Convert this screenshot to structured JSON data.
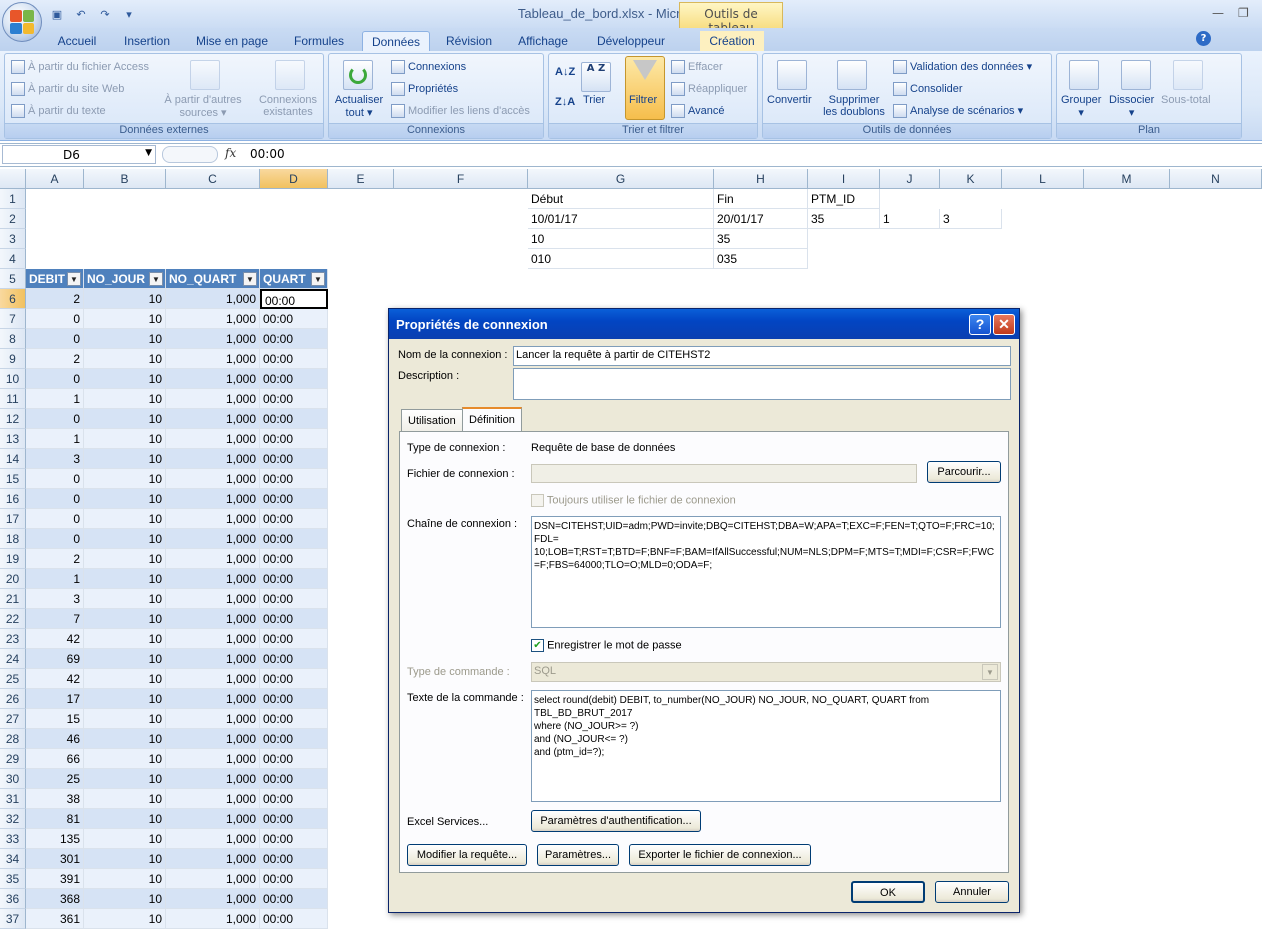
{
  "window": {
    "title": "Tableau_de_bord.xlsx - Microsoft Excel",
    "contextual_tab": "Outils de tableau"
  },
  "tabs": [
    "Accueil",
    "Insertion",
    "Mise en page",
    "Formules",
    "Données",
    "Révision",
    "Affichage",
    "Développeur",
    "Création"
  ],
  "ribbon": {
    "donnees_externes": {
      "label": "Données externes",
      "access": "À partir du fichier Access",
      "web": "À partir du site Web",
      "text": "À partir du texte",
      "other_sources_1": "À partir d'autres",
      "other_sources_2": "sources",
      "existing_1": "Connexions",
      "existing_2": "existantes"
    },
    "connexions": {
      "label": "Connexions",
      "refresh_1": "Actualiser",
      "refresh_2": "tout",
      "connections": "Connexions",
      "properties": "Propriétés",
      "edit_links": "Modifier les liens d'accès"
    },
    "trier_filtrer": {
      "label": "Trier et filtrer",
      "sort": "Trier",
      "filter": "Filtrer",
      "clear": "Effacer",
      "reapply": "Réappliquer",
      "advanced": "Avancé"
    },
    "outils": {
      "label": "Outils de données",
      "convert": "Convertir",
      "remove_dup_1": "Supprimer",
      "remove_dup_2": "les doublons",
      "validation": "Validation des données",
      "consolidate": "Consolider",
      "whatif": "Analyse de scénarios"
    },
    "plan": {
      "label": "Plan",
      "group": "Grouper",
      "ungroup": "Dissocier",
      "subtotal": "Sous-total"
    }
  },
  "formula_bar": {
    "cell_ref": "D6",
    "fx": "fx",
    "value": "00:00"
  },
  "columns": [
    "A",
    "B",
    "C",
    "D",
    "E",
    "F",
    "G",
    "H",
    "I",
    "J",
    "K",
    "L",
    "M",
    "N"
  ],
  "top_cells": {
    "g1": "Début",
    "h1": "Fin",
    "i1": "PTM_ID",
    "g2": "10/01/17",
    "h2": "20/01/17",
    "i2": "35",
    "j2": "1",
    "k2": "3",
    "g3": "10",
    "h3": "35",
    "g4": "010",
    "h4": "035"
  },
  "table_headers": [
    "DEBIT",
    "NO_JOUR",
    "NO_QUART",
    "QUART"
  ],
  "table_rows": [
    [
      2,
      10,
      "1,000",
      "00:00"
    ],
    [
      0,
      10,
      "1,000",
      "00:00"
    ],
    [
      0,
      10,
      "1,000",
      "00:00"
    ],
    [
      2,
      10,
      "1,000",
      "00:00"
    ],
    [
      0,
      10,
      "1,000",
      "00:00"
    ],
    [
      1,
      10,
      "1,000",
      "00:00"
    ],
    [
      0,
      10,
      "1,000",
      "00:00"
    ],
    [
      1,
      10,
      "1,000",
      "00:00"
    ],
    [
      3,
      10,
      "1,000",
      "00:00"
    ],
    [
      0,
      10,
      "1,000",
      "00:00"
    ],
    [
      0,
      10,
      "1,000",
      "00:00"
    ],
    [
      0,
      10,
      "1,000",
      "00:00"
    ],
    [
      0,
      10,
      "1,000",
      "00:00"
    ],
    [
      2,
      10,
      "1,000",
      "00:00"
    ],
    [
      1,
      10,
      "1,000",
      "00:00"
    ],
    [
      3,
      10,
      "1,000",
      "00:00"
    ],
    [
      7,
      10,
      "1,000",
      "00:00"
    ],
    [
      42,
      10,
      "1,000",
      "00:00"
    ],
    [
      69,
      10,
      "1,000",
      "00:00"
    ],
    [
      42,
      10,
      "1,000",
      "00:00"
    ],
    [
      17,
      10,
      "1,000",
      "00:00"
    ],
    [
      15,
      10,
      "1,000",
      "00:00"
    ],
    [
      46,
      10,
      "1,000",
      "00:00"
    ],
    [
      66,
      10,
      "1,000",
      "00:00"
    ],
    [
      25,
      10,
      "1,000",
      "00:00"
    ],
    [
      38,
      10,
      "1,000",
      "00:00"
    ],
    [
      81,
      10,
      "1,000",
      "00:00"
    ],
    [
      135,
      10,
      "1,000",
      "00:00"
    ],
    [
      301,
      10,
      "1,000",
      "00:00"
    ],
    [
      391,
      10,
      "1,000",
      "00:00"
    ],
    [
      368,
      10,
      "1,000",
      "00:00"
    ],
    [
      361,
      10,
      "1,000",
      "00:00"
    ]
  ],
  "dialog": {
    "title": "Propriétés de connexion",
    "name_label": "Nom de la connexion :",
    "name_value": "Lancer la requête à partir de CITEHST2",
    "desc_label": "Description :",
    "tab_usage": "Utilisation",
    "tab_definition": "Définition",
    "conn_type_label": "Type de connexion :",
    "conn_type_value": "Requête de base de données",
    "conn_file_label": "Fichier de connexion :",
    "browse": "Parcourir...",
    "always_use_file": "Toujours utiliser le fichier de connexion",
    "conn_string_label": "Chaîne de connexion :",
    "conn_string": "DSN=CITEHST;UID=adm;PWD=invite;DBQ=CITEHST;DBA=W;APA=T;EXC=F;FEN=T;QTO=F;FRC=10;FDL=\n10;LOB=T;RST=T;BTD=F;BNF=F;BAM=IfAllSuccessful;NUM=NLS;DPM=F;MTS=T;MDI=F;CSR=F;FWC=F;FBS=64000;TLO=O;MLD=0;ODA=F;",
    "save_password": "Enregistrer le mot de passe",
    "cmd_type_label": "Type de commande :",
    "cmd_type_value": "SQL",
    "cmd_text_label": "Texte de la commande :",
    "cmd_text": "select round(debit) DEBIT, to_number(NO_JOUR) NO_JOUR, NO_QUART, QUART from\nTBL_BD_BRUT_2017\nwhere (NO_JOUR>= ?)\nand (NO_JOUR<= ?)\nand (ptm_id=?);",
    "excel_services": "Excel Services...",
    "auth_params": "Paramètres d'authentification...",
    "edit_query": "Modifier la requête...",
    "parameters": "Paramètres...",
    "export_file": "Exporter le fichier de connexion...",
    "ok": "OK",
    "cancel": "Annuler"
  }
}
